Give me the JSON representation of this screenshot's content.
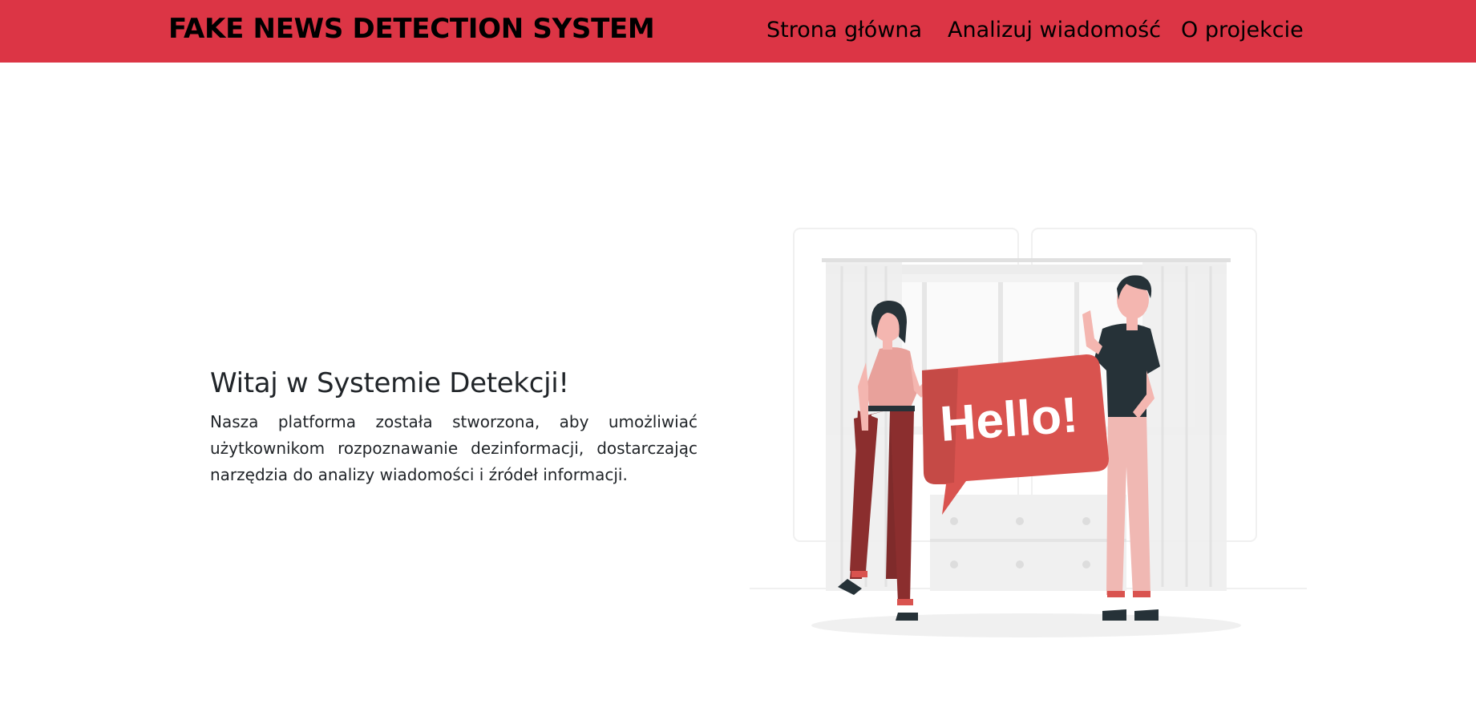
{
  "navbar": {
    "brand": "FAKE NEWS DETECTION SYSTEM",
    "links": [
      {
        "label": "Strona główna"
      },
      {
        "label": "Analizuj wiadomość"
      },
      {
        "label": "O projekcie"
      }
    ]
  },
  "hero": {
    "title": "Witaj w Systemie Detekcji!",
    "description": "Nasza platforma została stworzona, aby umożliwiać użytkownikom rozpoznawanie dezinformacji, dostarczając narzędzia do analizy wiadomości i źródeł informacji."
  },
  "illustration": {
    "bubble_text": "Hello!"
  },
  "colors": {
    "navbar": "#dc3545",
    "text_dark": "#212529",
    "accent_red": "#d9534f",
    "dark_red": "#8b2e2e",
    "pink": "#e8a19b",
    "charcoal": "#263238"
  }
}
